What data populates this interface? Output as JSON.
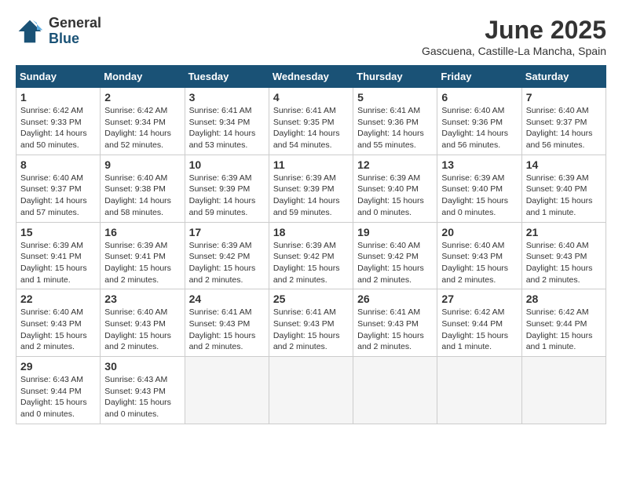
{
  "logo": {
    "general": "General",
    "blue": "Blue"
  },
  "title": "June 2025",
  "subtitle": "Gascuena, Castille-La Mancha, Spain",
  "days_header": [
    "Sunday",
    "Monday",
    "Tuesday",
    "Wednesday",
    "Thursday",
    "Friday",
    "Saturday"
  ],
  "weeks": [
    [
      {
        "day": "1",
        "info": "Sunrise: 6:42 AM\nSunset: 9:33 PM\nDaylight: 14 hours\nand 50 minutes."
      },
      {
        "day": "2",
        "info": "Sunrise: 6:42 AM\nSunset: 9:34 PM\nDaylight: 14 hours\nand 52 minutes."
      },
      {
        "day": "3",
        "info": "Sunrise: 6:41 AM\nSunset: 9:34 PM\nDaylight: 14 hours\nand 53 minutes."
      },
      {
        "day": "4",
        "info": "Sunrise: 6:41 AM\nSunset: 9:35 PM\nDaylight: 14 hours\nand 54 minutes."
      },
      {
        "day": "5",
        "info": "Sunrise: 6:41 AM\nSunset: 9:36 PM\nDaylight: 14 hours\nand 55 minutes."
      },
      {
        "day": "6",
        "info": "Sunrise: 6:40 AM\nSunset: 9:36 PM\nDaylight: 14 hours\nand 56 minutes."
      },
      {
        "day": "7",
        "info": "Sunrise: 6:40 AM\nSunset: 9:37 PM\nDaylight: 14 hours\nand 56 minutes."
      }
    ],
    [
      {
        "day": "8",
        "info": "Sunrise: 6:40 AM\nSunset: 9:37 PM\nDaylight: 14 hours\nand 57 minutes."
      },
      {
        "day": "9",
        "info": "Sunrise: 6:40 AM\nSunset: 9:38 PM\nDaylight: 14 hours\nand 58 minutes."
      },
      {
        "day": "10",
        "info": "Sunrise: 6:39 AM\nSunset: 9:39 PM\nDaylight: 14 hours\nand 59 minutes."
      },
      {
        "day": "11",
        "info": "Sunrise: 6:39 AM\nSunset: 9:39 PM\nDaylight: 14 hours\nand 59 minutes."
      },
      {
        "day": "12",
        "info": "Sunrise: 6:39 AM\nSunset: 9:40 PM\nDaylight: 15 hours\nand 0 minutes."
      },
      {
        "day": "13",
        "info": "Sunrise: 6:39 AM\nSunset: 9:40 PM\nDaylight: 15 hours\nand 0 minutes."
      },
      {
        "day": "14",
        "info": "Sunrise: 6:39 AM\nSunset: 9:40 PM\nDaylight: 15 hours\nand 1 minute."
      }
    ],
    [
      {
        "day": "15",
        "info": "Sunrise: 6:39 AM\nSunset: 9:41 PM\nDaylight: 15 hours\nand 1 minute."
      },
      {
        "day": "16",
        "info": "Sunrise: 6:39 AM\nSunset: 9:41 PM\nDaylight: 15 hours\nand 2 minutes."
      },
      {
        "day": "17",
        "info": "Sunrise: 6:39 AM\nSunset: 9:42 PM\nDaylight: 15 hours\nand 2 minutes."
      },
      {
        "day": "18",
        "info": "Sunrise: 6:39 AM\nSunset: 9:42 PM\nDaylight: 15 hours\nand 2 minutes."
      },
      {
        "day": "19",
        "info": "Sunrise: 6:40 AM\nSunset: 9:42 PM\nDaylight: 15 hours\nand 2 minutes."
      },
      {
        "day": "20",
        "info": "Sunrise: 6:40 AM\nSunset: 9:43 PM\nDaylight: 15 hours\nand 2 minutes."
      },
      {
        "day": "21",
        "info": "Sunrise: 6:40 AM\nSunset: 9:43 PM\nDaylight: 15 hours\nand 2 minutes."
      }
    ],
    [
      {
        "day": "22",
        "info": "Sunrise: 6:40 AM\nSunset: 9:43 PM\nDaylight: 15 hours\nand 2 minutes."
      },
      {
        "day": "23",
        "info": "Sunrise: 6:40 AM\nSunset: 9:43 PM\nDaylight: 15 hours\nand 2 minutes."
      },
      {
        "day": "24",
        "info": "Sunrise: 6:41 AM\nSunset: 9:43 PM\nDaylight: 15 hours\nand 2 minutes."
      },
      {
        "day": "25",
        "info": "Sunrise: 6:41 AM\nSunset: 9:43 PM\nDaylight: 15 hours\nand 2 minutes."
      },
      {
        "day": "26",
        "info": "Sunrise: 6:41 AM\nSunset: 9:43 PM\nDaylight: 15 hours\nand 2 minutes."
      },
      {
        "day": "27",
        "info": "Sunrise: 6:42 AM\nSunset: 9:44 PM\nDaylight: 15 hours\nand 1 minute."
      },
      {
        "day": "28",
        "info": "Sunrise: 6:42 AM\nSunset: 9:44 PM\nDaylight: 15 hours\nand 1 minute."
      }
    ],
    [
      {
        "day": "29",
        "info": "Sunrise: 6:43 AM\nSunset: 9:44 PM\nDaylight: 15 hours\nand 0 minutes."
      },
      {
        "day": "30",
        "info": "Sunrise: 6:43 AM\nSunset: 9:43 PM\nDaylight: 15 hours\nand 0 minutes."
      },
      {
        "day": "",
        "info": ""
      },
      {
        "day": "",
        "info": ""
      },
      {
        "day": "",
        "info": ""
      },
      {
        "day": "",
        "info": ""
      },
      {
        "day": "",
        "info": ""
      }
    ]
  ]
}
